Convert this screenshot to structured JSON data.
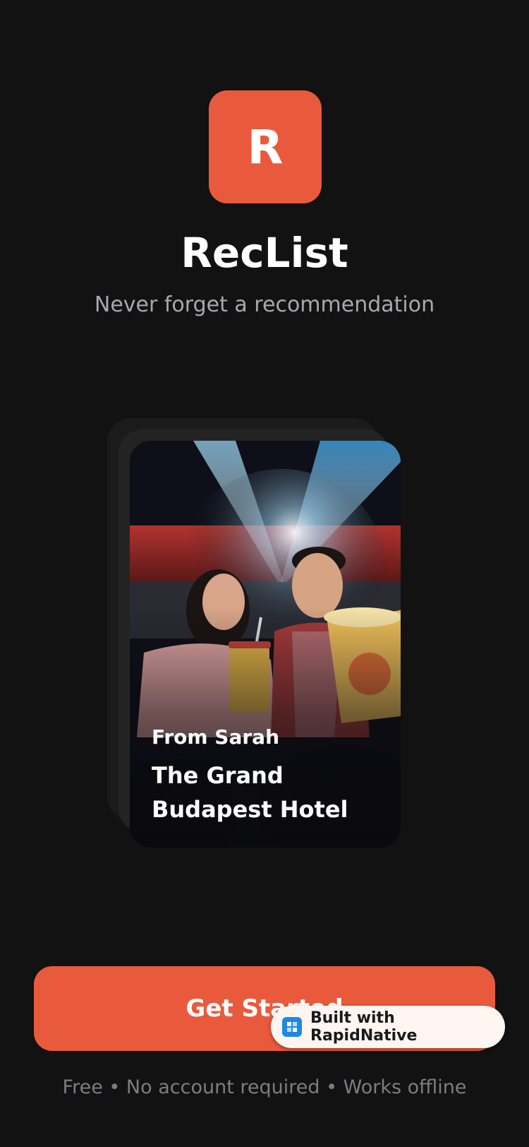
{
  "app": {
    "logo_letter": "R",
    "name": "RecList",
    "tagline": "Never forget a recommendation"
  },
  "card": {
    "image_description_icon": "cinema-couple-photo",
    "from_label": "From Sarah",
    "title": "The Grand Budapest Hotel"
  },
  "cta": {
    "label": "Get Started"
  },
  "badge": {
    "label": "Built with RapidNative"
  },
  "footnote": "Free • No account required • Works offline",
  "colors": {
    "background": "#121212",
    "accent": "#e95a3c",
    "muted_text": "#a8a8b3",
    "footnote_text": "#7c7c85"
  }
}
